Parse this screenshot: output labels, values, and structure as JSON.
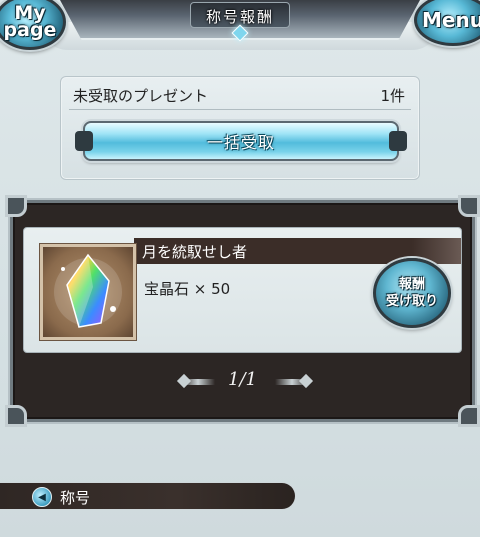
{
  "header": {
    "title": "称号報酬",
    "mypage_label_line1": "My",
    "mypage_label_line2": "page",
    "menu_label": "Menu"
  },
  "present": {
    "label": "未受取のプレゼント",
    "count": "1件",
    "bulk_button": "一括受取"
  },
  "reward": {
    "name": "月を統馭せし者",
    "item": "宝晶石",
    "quantity_text": "× 50",
    "receive_line1": "報酬",
    "receive_line2": "受け取り",
    "thumb_icon": "crystal-icon"
  },
  "pager": {
    "text": "1/1"
  },
  "footer": {
    "label": "称号",
    "icon": "back-arrow-icon"
  },
  "colors": {
    "accent_blue": "#52bcdc",
    "frame_dark": "#2c2624",
    "panel_light": "#e8eff1"
  }
}
